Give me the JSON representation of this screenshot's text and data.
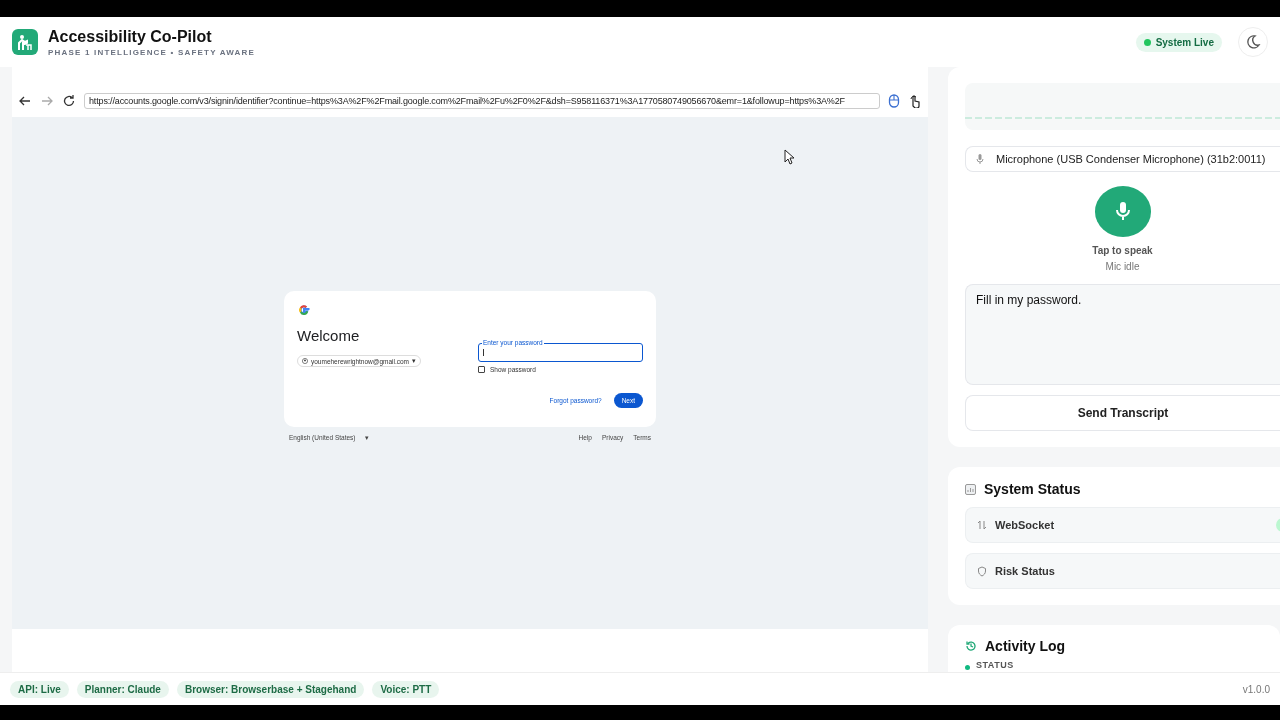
{
  "header": {
    "title": "Accessibility Co-Pilot",
    "subtitle": "PHASE 1 INTELLIGENCE • SAFETY AWARE",
    "status": {
      "label": "System Live",
      "color": "#22c55e"
    }
  },
  "browser": {
    "url": "https://accounts.google.com/v3/signin/identifier?continue=https%3A%2F%2Fmail.google.com%2Fmail%2Fu%2F0%2F&dsh=S958116371%3A1770580749056670&emr=1&followup=https%3A%2F",
    "page": {
      "heading": "Welcome",
      "account": "youmeherewrightnow@gmail.com",
      "account_caret": "▾",
      "password_label": "Enter your password",
      "show_password": {
        "label": "Show password",
        "checked": false
      },
      "forgot": "Forgot password?",
      "next": "Next",
      "language": "English (United States)",
      "language_caret": "▾",
      "links": [
        "Help",
        "Privacy",
        "Terms"
      ]
    }
  },
  "voice": {
    "device": "Microphone (USB Condenser Microphone) (31b2:0011)",
    "mic_label": "Tap to speak",
    "mic_state": "Mic idle",
    "transcript": "Fill in my password.",
    "send": "Send Transcript"
  },
  "system_status": {
    "title": "System Status",
    "rows": [
      {
        "kind": "socket",
        "label": "WebSocket",
        "color": "#bbf7d0"
      },
      {
        "kind": "risk",
        "label": "Risk Status"
      }
    ]
  },
  "activity_log": {
    "title": "Activity Log",
    "entries": [
      {
        "label": "STATUS",
        "color": "#10b981"
      }
    ]
  },
  "footer": {
    "chips": [
      "API: Live",
      "Planner: Claude",
      "Browser: Browserbase + Stagehand",
      "Voice: PTT"
    ],
    "version": "v1.0.0"
  }
}
